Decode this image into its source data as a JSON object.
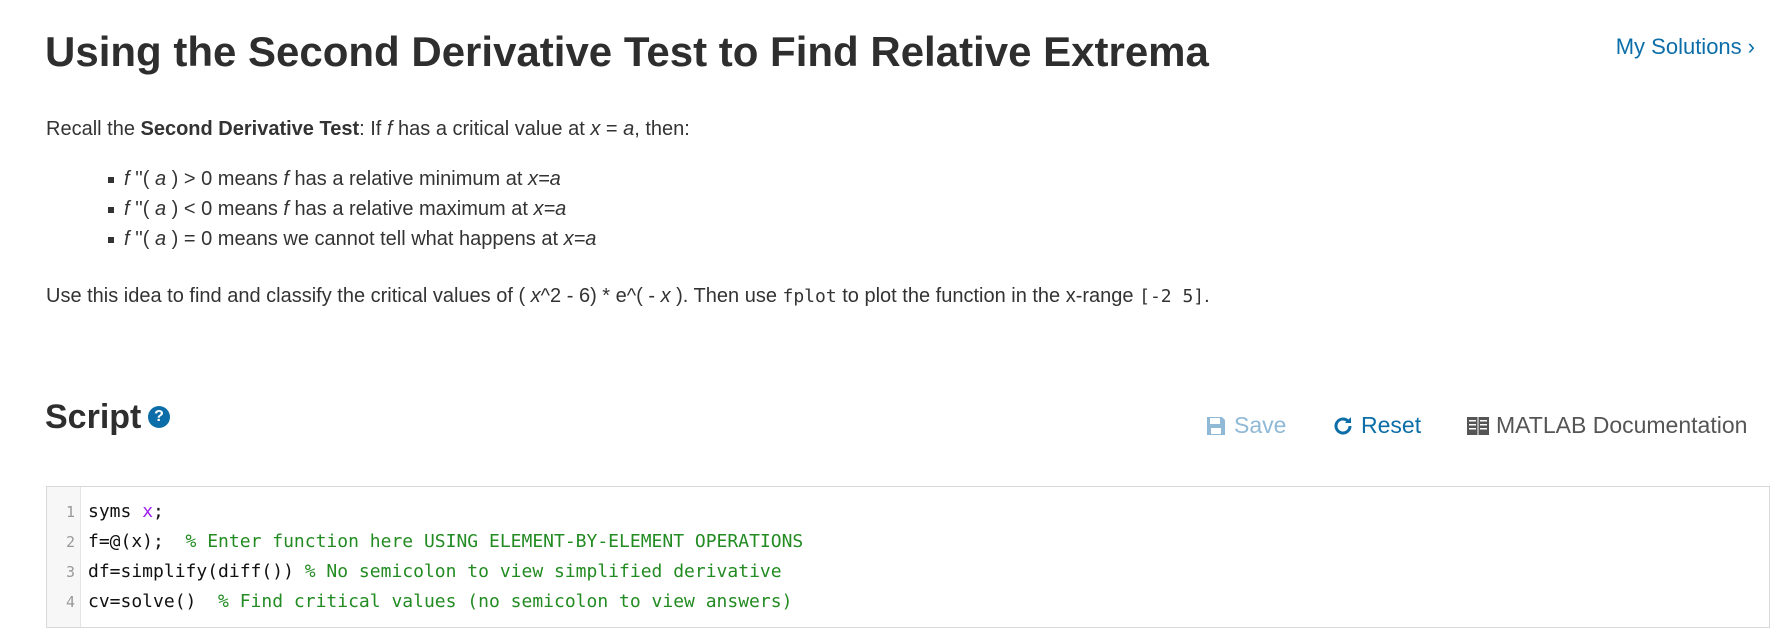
{
  "header": {
    "title": "Using the Second Derivative Test to Find Relative Extrema",
    "my_solutions": "My Solutions",
    "chevron": "›"
  },
  "intro": {
    "prefix": "Recall the ",
    "bold": "Second Derivative Test",
    "mid1": ": If ",
    "f": "f",
    "mid2": " has a critical value at ",
    "x": "x",
    "eq": " = ",
    "a": "a",
    "suffix": ", then:"
  },
  "bullets": [
    {
      "f": "f",
      "pre": " ''( ",
      "a": "a",
      "rel": " ) > 0 means ",
      "f2": "f",
      "rest": " has a relative minimum at ",
      "xa": "x=a"
    },
    {
      "f": "f",
      "pre": " ''( ",
      "a": "a",
      "rel": " ) < 0 means ",
      "f2": "f",
      "rest": " has a relative maximum at ",
      "xa": "x=a"
    },
    {
      "f": "f",
      "pre": " ''( ",
      "a": "a",
      "rel": " ) = 0 means we cannot tell what happens at ",
      "xa": "x=a"
    }
  ],
  "task": {
    "prefix": "Use this idea to find and classify the critical values of ( ",
    "x1": "x",
    "mid": "^2 - 6) * e^( - ",
    "x2": "x",
    "mid2": " ). Then use ",
    "code1": "fplot",
    "mid3": " to plot the function in the x-range ",
    "code2": "[-2 5]",
    "suffix": "."
  },
  "script": {
    "title": "Script",
    "help_icon": "?",
    "save_label": "Save",
    "reset_label": "Reset",
    "doc_label": "MATLAB Documentation"
  },
  "code_lines": [
    {
      "num": "1",
      "a": "syms ",
      "var": "x",
      "b": ";",
      "comment": ""
    },
    {
      "num": "2",
      "a": "f=@(x);  ",
      "var": "",
      "b": "",
      "comment": "% Enter function here USING ELEMENT-BY-ELEMENT OPERATIONS"
    },
    {
      "num": "3",
      "a": "df=simplify(diff()) ",
      "var": "",
      "b": "",
      "comment": "% No semicolon to view simplified derivative"
    },
    {
      "num": "4",
      "a": "cv=solve()  ",
      "var": "",
      "b": "",
      "comment": "% Find critical values (no semicolon to view answers)"
    }
  ],
  "colors": {
    "link": "#0c6ea8",
    "save_disabled": "#8fb9d6",
    "comment": "#228b22",
    "variable": "#a020f0"
  },
  "icons": [
    "help-icon",
    "save-icon",
    "reset-icon",
    "documentation-icon",
    "chevron-right-icon"
  ]
}
